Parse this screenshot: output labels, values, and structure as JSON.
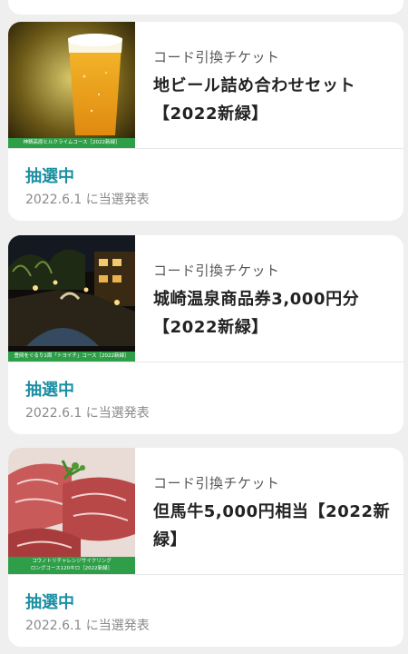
{
  "cards": [
    {
      "ticket_type": "コード引換チケット",
      "title": "地ビール詰め合わせセット【2022新緑】",
      "thumb_caption": "神鍋高原ヒルクライムコース［2022新緑］",
      "thumb_kind": "beer",
      "status": "抽選中",
      "date_text": "2022.6.1 に当選発表"
    },
    {
      "ticket_type": "コード引換チケット",
      "title": "城崎温泉商品券3,000円分【2022新緑】",
      "thumb_caption": "豊岡をぐるり1周「トヨイチ」コース［2022新緑］",
      "thumb_kind": "onsen",
      "status": "抽選中",
      "date_text": "2022.6.1 に当選発表"
    },
    {
      "ticket_type": "コード引換チケット",
      "title": "但馬牛5,000円相当【2022新緑】",
      "thumb_caption": "コウノトリチャレンジサイクリング\nロングコース120キロ［2022新緑］",
      "thumb_kind": "beef",
      "status": "抽選中",
      "date_text": "2022.6.1 に当選発表"
    }
  ],
  "colors": {
    "status": "#1a8fa3",
    "caption_bg": "#2e9e48",
    "background": "#efefef"
  }
}
